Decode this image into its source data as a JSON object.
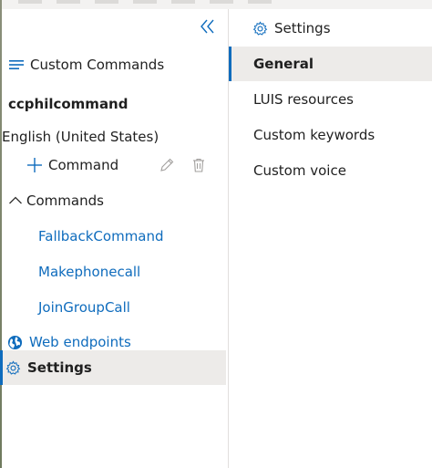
{
  "left_panel": {
    "header_label": "Custom Commands",
    "project_name": "ccphilcommand",
    "language": "English (United States)",
    "add_command_label": "Command",
    "commands_header": "Commands",
    "commands": [
      "FallbackCommand",
      "Makephonecall",
      "JoinGroupCall"
    ],
    "web_endpoints_label": "Web endpoints",
    "settings_label": "Settings"
  },
  "right_panel": {
    "header": "Settings",
    "nav": [
      {
        "label": "General",
        "active": true
      },
      {
        "label": "LUIS resources",
        "active": false
      },
      {
        "label": "Custom keywords",
        "active": false
      },
      {
        "label": "Custom voice",
        "active": false
      }
    ]
  },
  "colors": {
    "accent": "#0f6cbd",
    "selected_bg": "#edebe9",
    "divider": "#e1dfdd",
    "text": "#1f1f1f",
    "muted_icon": "#a19f9d"
  },
  "icons": [
    "collapse-icon",
    "hamburger-icon",
    "plus-icon",
    "edit-icon",
    "delete-icon",
    "chevron-up-icon",
    "globe-icon",
    "gear-icon"
  ]
}
